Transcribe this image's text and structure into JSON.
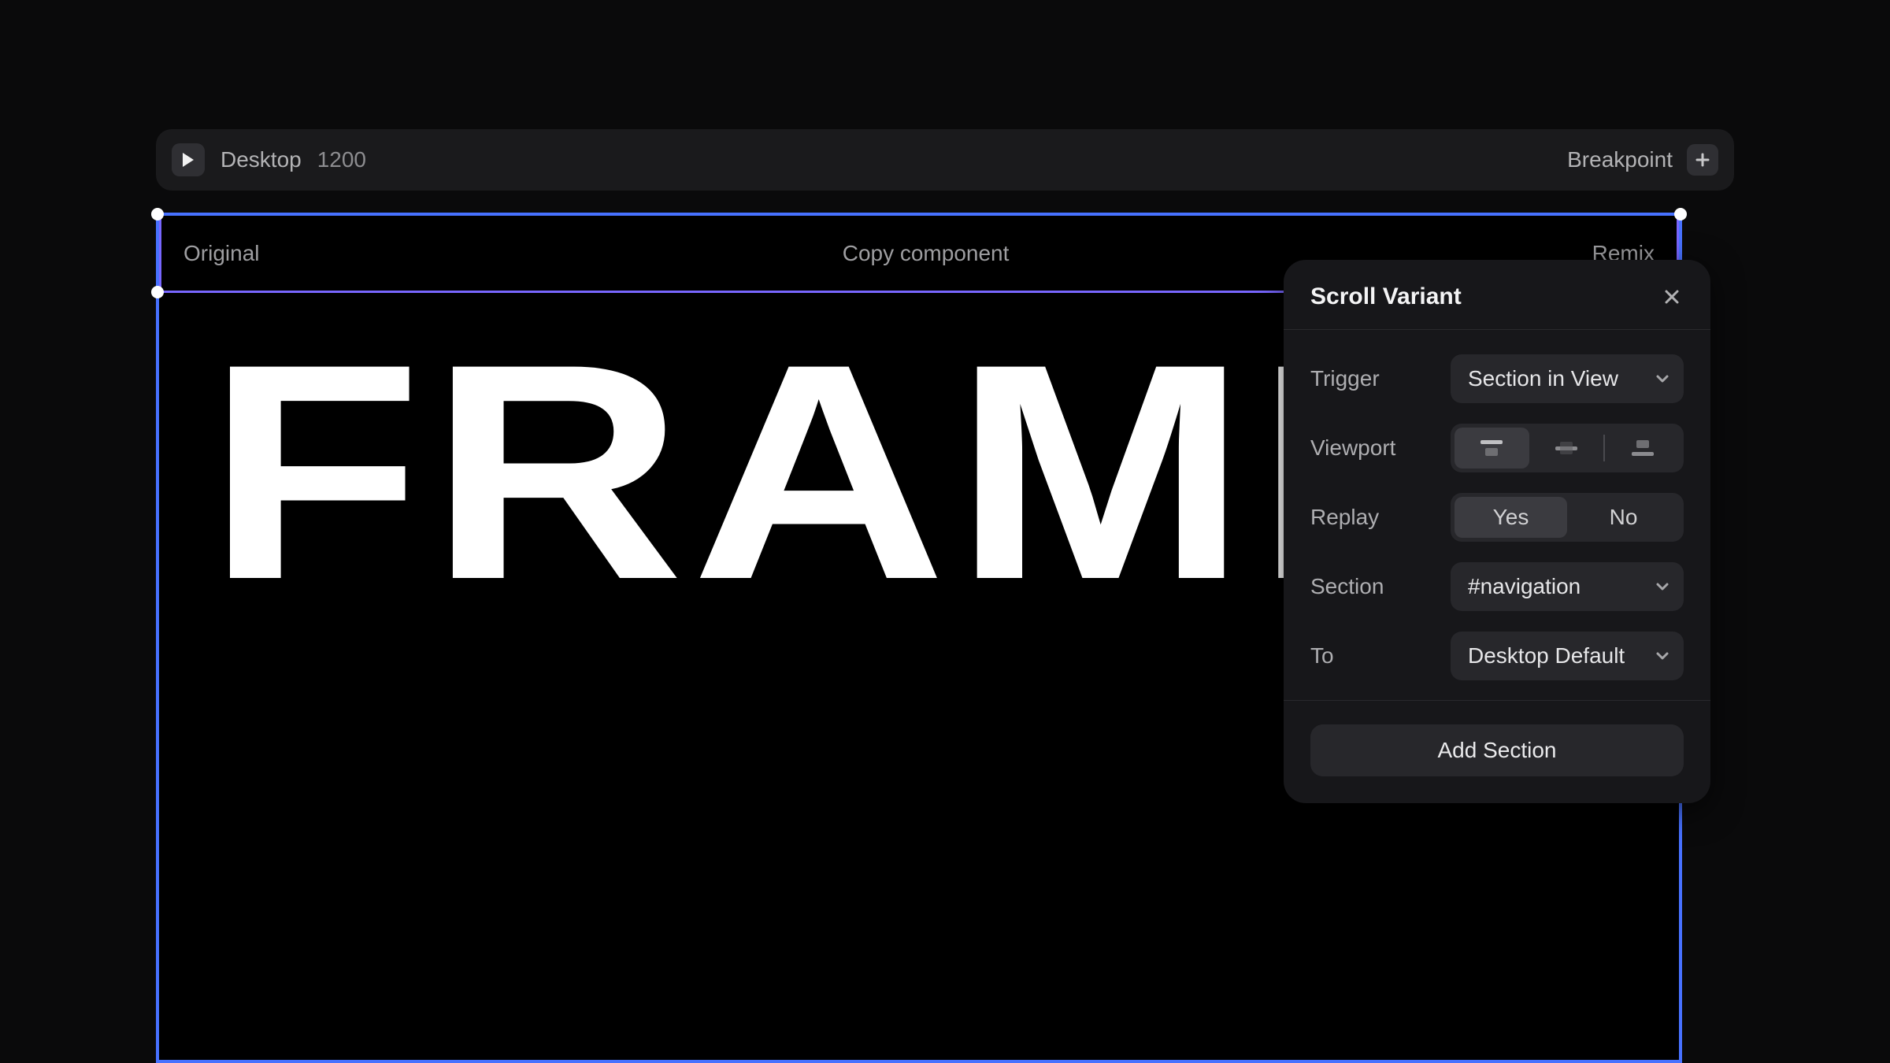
{
  "toolbar": {
    "device": "Desktop",
    "width": "1200",
    "breakpoint_label": "Breakpoint"
  },
  "selection": {
    "left": "Original",
    "center": "Copy component",
    "right": "Remix"
  },
  "hero": "FRAME",
  "popover": {
    "title": "Scroll Variant",
    "trigger": {
      "label": "Trigger",
      "value": "Section in View"
    },
    "viewport": {
      "label": "Viewport",
      "selected": "top"
    },
    "replay": {
      "label": "Replay",
      "yes": "Yes",
      "no": "No",
      "selected": "Yes"
    },
    "section": {
      "label": "Section",
      "value": "#navigation"
    },
    "to": {
      "label": "To",
      "value": "Desktop Default"
    },
    "add_section": "Add Section"
  }
}
